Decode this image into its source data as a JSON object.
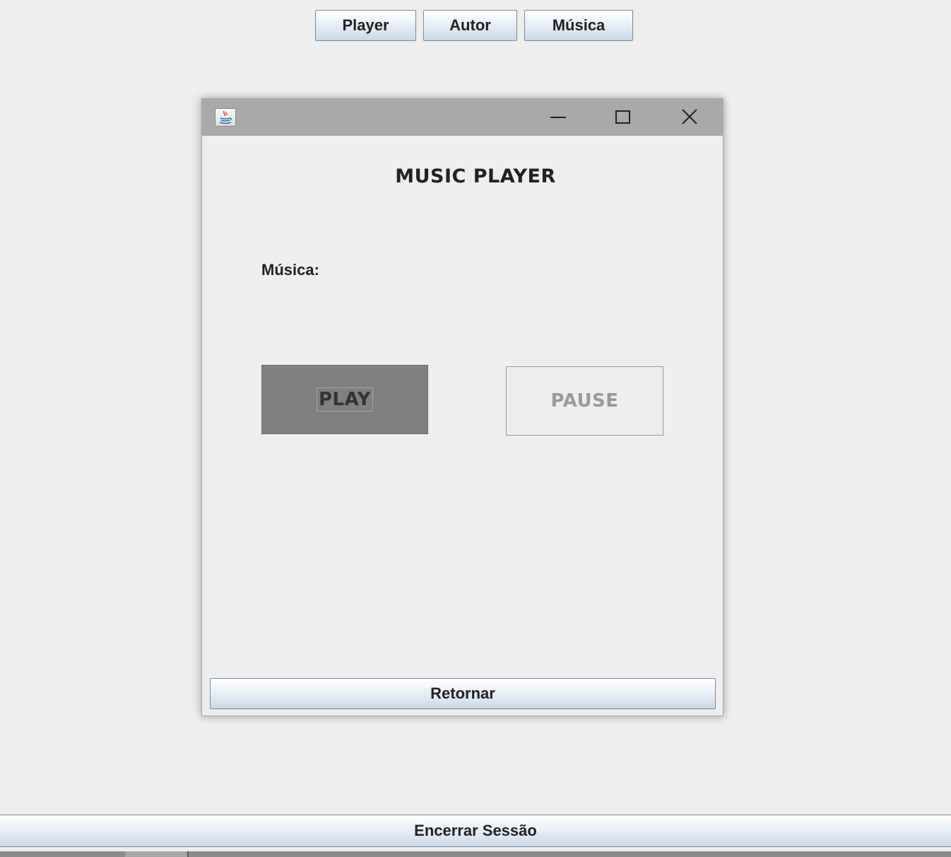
{
  "top_tabs": {
    "player": "Player",
    "autor": "Autor",
    "musica": "Música"
  },
  "window": {
    "icon": "java-coffee-icon",
    "controls": [
      "minimize-icon",
      "maximize-icon",
      "close-icon"
    ],
    "heading": "MUSIC PLAYER",
    "song_label": "Música:",
    "play_label": "PLAY",
    "pause_label": "PAUSE",
    "return_label": "Retornar"
  },
  "footer": {
    "logout_label": "Encerrar Sessão"
  },
  "colors": {
    "background": "#eeeeee",
    "titlebar": "#a9a9a9",
    "play_button_bg": "#808080",
    "pause_text_disabled": "#9a9a9a"
  }
}
